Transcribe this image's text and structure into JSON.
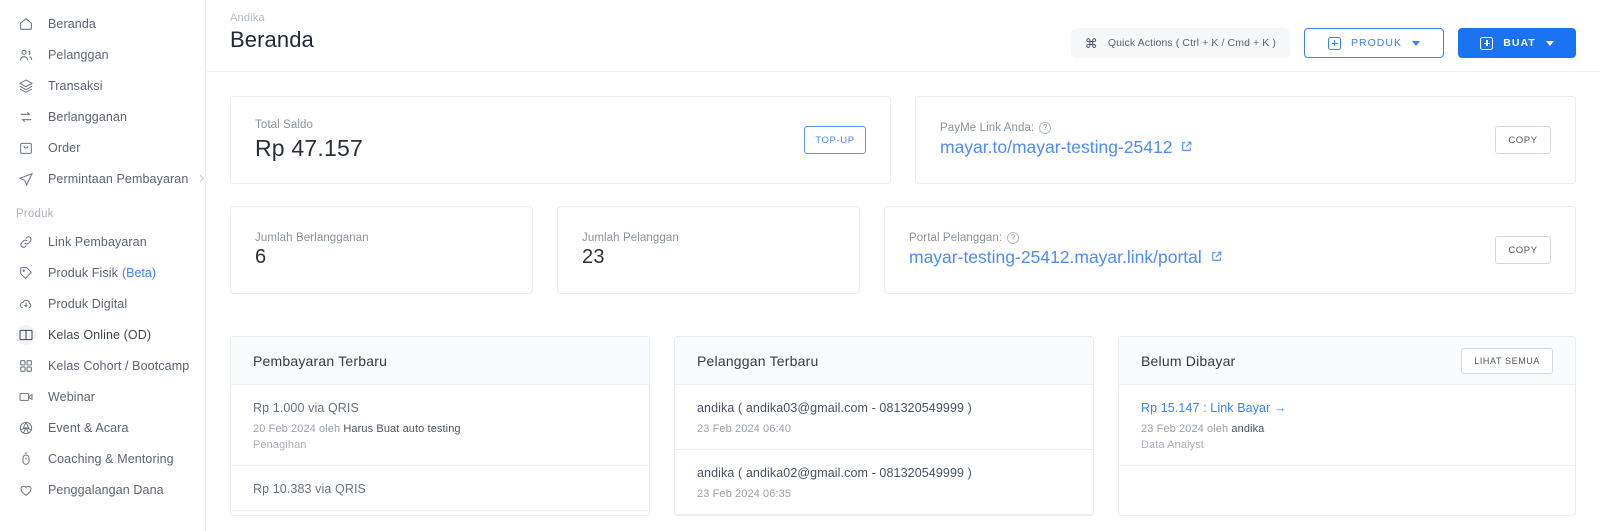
{
  "sidebar": {
    "items": [
      {
        "label": "Beranda",
        "icon": "home-icon",
        "active": false
      },
      {
        "label": "Pelanggan",
        "icon": "users-icon",
        "active": false
      },
      {
        "label": "Transaksi",
        "icon": "layers-icon",
        "active": false
      },
      {
        "label": "Berlangganan",
        "icon": "refresh-icon",
        "active": false
      },
      {
        "label": "Order",
        "icon": "bag-icon",
        "active": false
      },
      {
        "label": "Permintaan Pembayaran",
        "icon": "send-icon",
        "active": false,
        "chevron": true
      }
    ],
    "section_label": "Produk",
    "product_items": [
      {
        "label": "Link Pembayaran",
        "icon": "link-icon",
        "active": false
      },
      {
        "label": "Produk Fisik",
        "badge": "(Beta)",
        "icon": "tag-icon",
        "active": false
      },
      {
        "label": "Produk Digital",
        "icon": "cloud-download-icon",
        "active": false
      },
      {
        "label": "Kelas Online (OD)",
        "icon": "book-icon",
        "active": true
      },
      {
        "label": "Kelas Cohort / Bootcamp",
        "icon": "grid-icon",
        "active": false
      },
      {
        "label": "Webinar",
        "icon": "video-icon",
        "active": false
      },
      {
        "label": "Event & Acara",
        "icon": "ticket-icon",
        "active": false
      },
      {
        "label": "Coaching & Mentoring",
        "icon": "stopwatch-icon",
        "active": false
      },
      {
        "label": "Penggalangan Dana",
        "icon": "heart-icon",
        "active": false
      }
    ]
  },
  "header": {
    "breadcrumb": "Andika",
    "title": "Beranda",
    "quick_actions": "Quick Actions ( Ctrl + K / Cmd + K )",
    "quick_actions_key": "⌘",
    "produk_button": "PRODUK",
    "buat_button": "BUAT"
  },
  "cards": {
    "saldo": {
      "label": "Total Saldo",
      "value": "Rp 47.157",
      "action": "TOP-UP"
    },
    "payme": {
      "label": "PayMe Link Anda:",
      "link": "mayar.to/mayar-testing-25412",
      "action": "COPY"
    },
    "berlangganan": {
      "label": "Jumlah Berlangganan",
      "value": "6"
    },
    "pelanggan": {
      "label": "Jumlah Pelanggan",
      "value": "23"
    },
    "portal": {
      "label": "Portal Pelanggan:",
      "link": "mayar-testing-25412.mayar.link/portal",
      "action": "COPY"
    }
  },
  "panels": {
    "pembayaran": {
      "title": "Pembayaran Terbaru",
      "rows": [
        {
          "amount": "Rp 1.000 via QRIS",
          "meta_pre": "20 Feb 2024 oleh ",
          "meta_name": "Harus Buat auto testing",
          "extra": "Penagihan"
        },
        {
          "amount": "Rp 10.383 via QRIS",
          "meta_pre": "",
          "meta_name": "",
          "extra": ""
        }
      ]
    },
    "pelanggan": {
      "title": "Pelanggan Terbaru",
      "rows": [
        {
          "name": "andika ( andika03@gmail.com - 081320549999 )",
          "date": "23 Feb 2024 06:40"
        },
        {
          "name": "andika ( andika02@gmail.com - 081320549999 )",
          "date": "23 Feb 2024 06:35"
        }
      ]
    },
    "belum_dibayar": {
      "title": "Belum Dibayar",
      "action": "LIHAT SEMUA",
      "rows": [
        {
          "link": "Rp 15.147 : Link Bayar →",
          "meta_pre": "23 Feb 2024 oleh ",
          "meta_name": "andika",
          "extra": "Data Analyst"
        }
      ]
    }
  },
  "colors": {
    "accent": "#1a73f2",
    "link": "#3b82f6",
    "border": "#e9ecf1",
    "muted": "#8b929d"
  }
}
